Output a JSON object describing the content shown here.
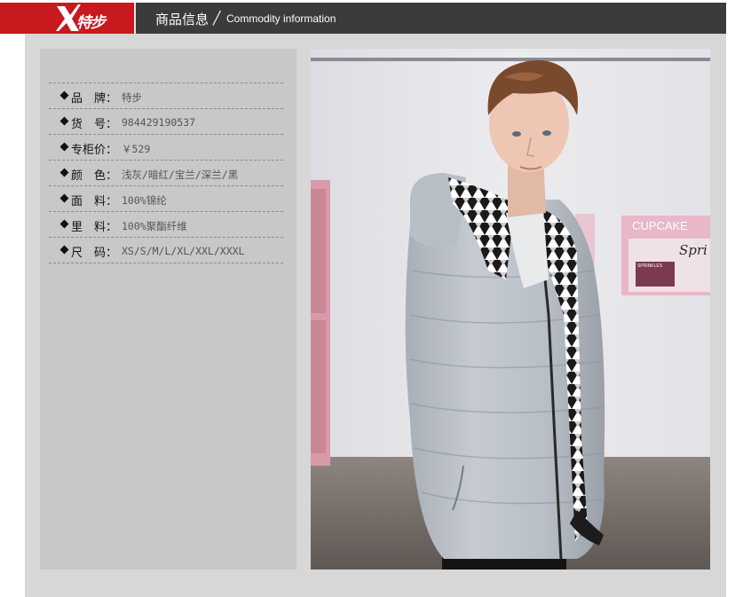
{
  "header": {
    "brand_text": "特步",
    "section_title": "商品信息",
    "slash": "╱",
    "section_subtitle": "Commodity information"
  },
  "product_info": [
    {
      "label": "品　牌：",
      "value": "特步"
    },
    {
      "label": "货　号：",
      "value": "984429190537"
    },
    {
      "label": "专柜价：",
      "value": "￥529"
    },
    {
      "label": "颜　色：",
      "value": "浅灰/暗红/宝兰/深兰/黑"
    },
    {
      "label": "面　料：",
      "value": "100%锦纶"
    },
    {
      "label": "里　料：",
      "value": "100%聚酯纤维"
    },
    {
      "label": "尺　码：",
      "value": "XS/S/M/L/XL/XXL/XXXL"
    }
  ],
  "photo": {
    "sign_text": "CUPCAKE",
    "sign_script": "Spri",
    "box_text": "SPRINKLES"
  },
  "colors": {
    "brand_red": "#c8191e",
    "header_bg": "#3b3b3b",
    "content_bg": "#d7d7d7",
    "panel_bg": "#c8c8c8"
  }
}
